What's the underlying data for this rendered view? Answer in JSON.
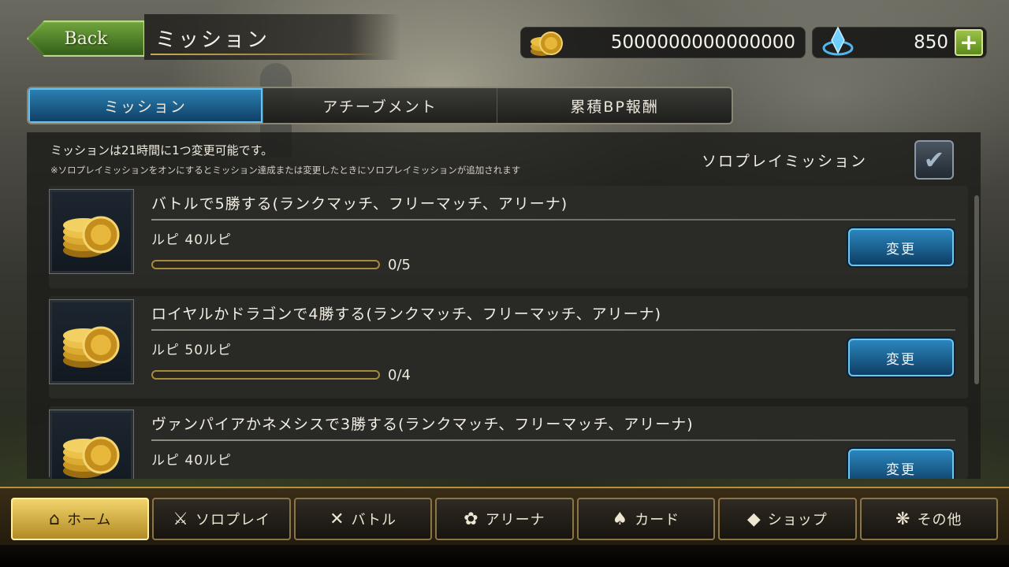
{
  "header": {
    "back_label": "Back",
    "title": "ミッション"
  },
  "currency": {
    "coins": "5000000000000000",
    "crystals": "850",
    "plus_label": "+"
  },
  "tabs": [
    {
      "label": "ミッション",
      "active": true
    },
    {
      "label": "アチーブメント",
      "active": false
    },
    {
      "label": "累積BP報酬",
      "active": false
    }
  ],
  "info": {
    "line1": "ミッションは21時間に1つ変更可能です。",
    "line2": "※ソロプレイミッションをオンにするとミッション達成または変更したときにソロプレイミッションが追加されます",
    "solo_label": "ソロプレイミッション",
    "solo_checked": true
  },
  "missions": [
    {
      "title": "バトルで5勝する(ランクマッチ、フリーマッチ、アリーナ)",
      "reward": "ルピ 40ルピ",
      "progress": "0/5",
      "fraction": 0,
      "button": "変更"
    },
    {
      "title": "ロイヤルかドラゴンで4勝する(ランクマッチ、フリーマッチ、アリーナ)",
      "reward": "ルピ 50ルピ",
      "progress": "0/4",
      "fraction": 0,
      "button": "変更"
    },
    {
      "title": "ヴァンパイアかネメシスで3勝する(ランクマッチ、フリーマッチ、アリーナ)",
      "reward": "ルピ 40ルピ",
      "progress": "",
      "fraction": 0,
      "button": "変更"
    }
  ],
  "nav": [
    {
      "label": "ホーム",
      "icon": "home-icon",
      "active": true
    },
    {
      "label": "ソロプレイ",
      "icon": "sword-icon",
      "active": false
    },
    {
      "label": "バトル",
      "icon": "crossed-swords-icon",
      "active": false
    },
    {
      "label": "アリーナ",
      "icon": "laurel-icon",
      "active": false
    },
    {
      "label": "カード",
      "icon": "cards-icon",
      "active": false
    },
    {
      "label": "ショップ",
      "icon": "gem-icon",
      "active": false
    },
    {
      "label": "その他",
      "icon": "menu-dots-icon",
      "active": false
    }
  ]
}
